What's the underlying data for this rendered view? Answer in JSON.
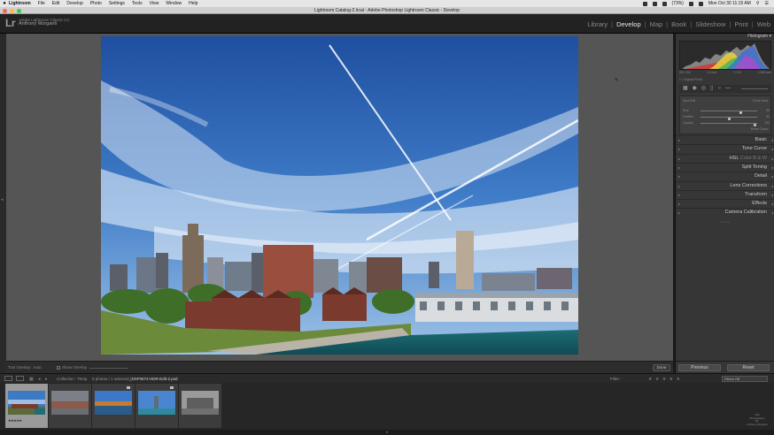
{
  "menubar": {
    "items": [
      "Lightroom",
      "File",
      "Edit",
      "Develop",
      "Photo",
      "Settings",
      "Tools",
      "View",
      "Window",
      "Help"
    ],
    "battery": "(73%)",
    "datetime": "Mon Oct 30  11:15 AM"
  },
  "window": {
    "title": "Lightroom Catalog-2.lrcat - Adobe Photoshop Lightroom Classic - Develop",
    "traffic_colors": [
      "#fc605b",
      "#fdbc40",
      "#34c84a"
    ]
  },
  "identity": {
    "logo": "Lr",
    "line1": "Adobe Lightroom Classic CC",
    "name": "Anthony Morganti"
  },
  "modules": {
    "items": [
      "Library",
      "Develop",
      "Map",
      "Book",
      "Slideshow",
      "Print",
      "Web"
    ],
    "active": "Develop",
    "separator": "|"
  },
  "right_panel": {
    "histogram_title": "Histogram",
    "hist_info": [
      "ISO 200",
      "14 mm",
      "f / 8.0",
      "1/250 sec"
    ],
    "original_photo": "Original Photo",
    "mask": {
      "header_left": "Spot Edit",
      "header_right": "Clone   Heal",
      "rows": [
        {
          "label": "Size",
          "value": "58",
          "pos": 0.72
        },
        {
          "label": "Feather",
          "value": "33",
          "pos": 0.5
        },
        {
          "label": "Opacity",
          "value": "100",
          "pos": 0.98
        }
      ],
      "footer": "Reset   Close"
    },
    "sections": [
      "Basic",
      "Tone Curve",
      "HSL",
      "Split Toning",
      "Detail",
      "Lens Corrections",
      "Transform",
      "Effects",
      "Camera Calibration"
    ],
    "hsl_extra": "Color   B & W",
    "end_ornament": "~~~"
  },
  "toolbar": {
    "overlay_label": "Tool Overlay : Auto",
    "show_overlay": "Show Overlay",
    "done": "Done"
  },
  "buttons": {
    "previous": "Previous",
    "reset": "Reset"
  },
  "filmbar": {
    "source": "Collection : Temp",
    "count": "5 photos / 1 selected /",
    "filename": "_DSF0674-HDR-Edit-2.psd",
    "filter_label": "Filter :",
    "stars": "★ ★ ★ ★ ★",
    "filter_value": "Filters Off"
  },
  "filmstrip": {
    "selected_rating": "★★★★★",
    "watermark": "Visit\nPhotography\nBy\nAnthony Morganti"
  },
  "colors": {
    "accent": "#e8e8e8",
    "panel": "#363636",
    "sky_top": "#2a5fb0"
  }
}
